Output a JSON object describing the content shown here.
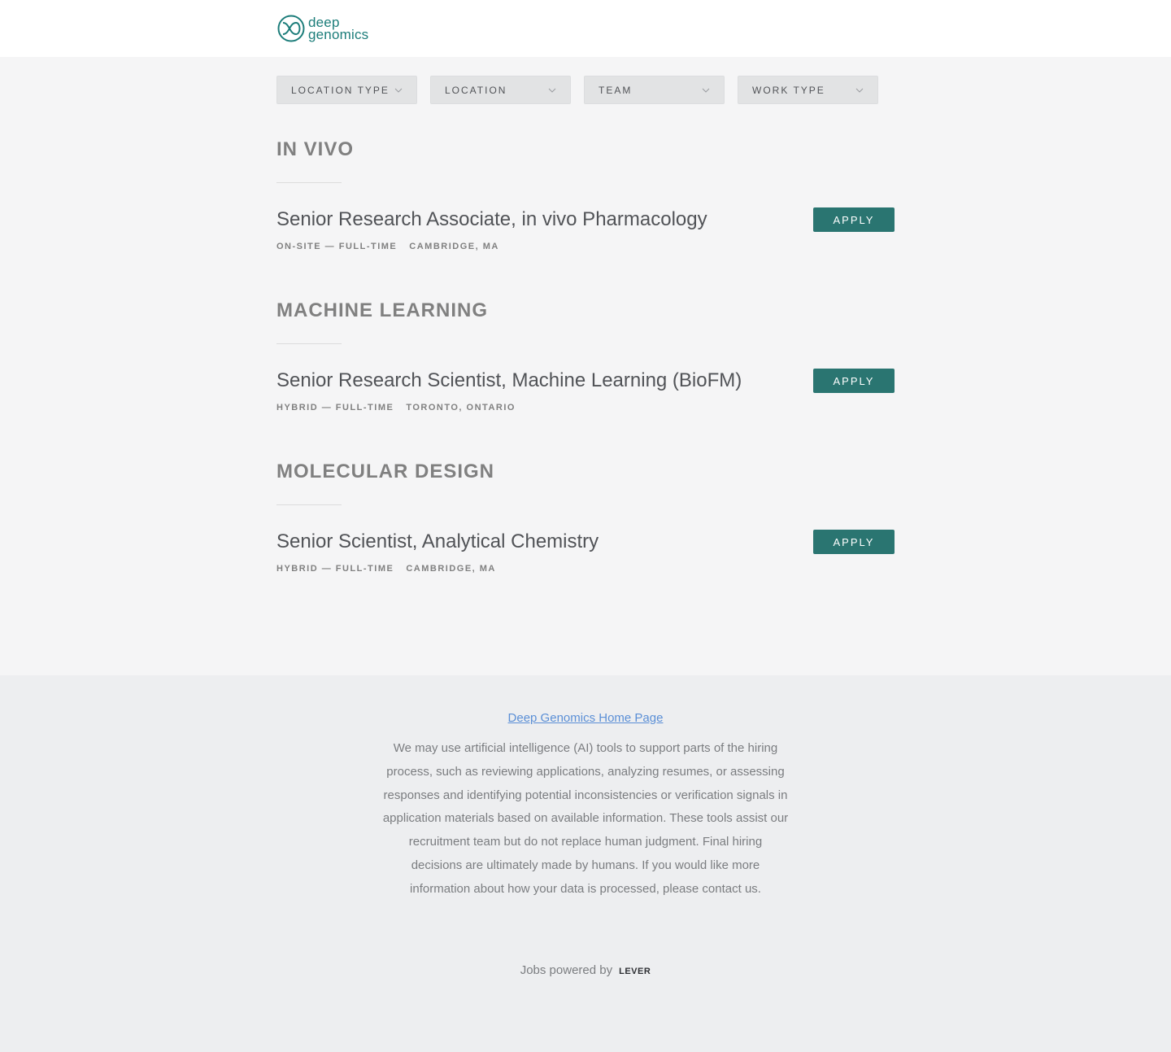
{
  "brand": {
    "logo_line1": "deep",
    "logo_line2": "genomics",
    "color": "#1c7d7a"
  },
  "filters": [
    {
      "label": "LOCATION TYPE"
    },
    {
      "label": "LOCATION"
    },
    {
      "label": "TEAM"
    },
    {
      "label": "WORK TYPE"
    }
  ],
  "teams": [
    {
      "name": "IN VIVO",
      "postings": [
        {
          "title": "Senior Research Associate, in vivo Pharmacology",
          "workplace": "ON-SITE — FULL-TIME",
          "location": "CAMBRIDGE, MA",
          "apply_label": "APPLY"
        }
      ]
    },
    {
      "name": "MACHINE LEARNING",
      "postings": [
        {
          "title": "Senior Research Scientist, Machine Learning (BioFM)",
          "workplace": "HYBRID — FULL-TIME",
          "location": "TORONTO, ONTARIO",
          "apply_label": "APPLY"
        }
      ]
    },
    {
      "name": "MOLECULAR DESIGN",
      "postings": [
        {
          "title": "Senior Scientist, Analytical Chemistry",
          "workplace": "HYBRID — FULL-TIME",
          "location": "CAMBRIDGE, MA",
          "apply_label": "APPLY"
        }
      ]
    }
  ],
  "footer": {
    "home_link": "Deep Genomics Home Page",
    "ai_notice": "We may use artificial intelligence (AI) tools to support parts of the hiring process, such as reviewing applications, analyzing resumes, or assessing responses and identifying potential inconsistencies or verification signals in application materials based on available information. These tools assist our recruitment team but do not replace human judgment. Final hiring decisions are ultimately made by humans. If you would like more information about how your data is processed, please contact us.",
    "powered_by": "Jobs powered by",
    "lever": "LEVER"
  },
  "colors": {
    "apply_button": "#2a7571",
    "link": "#5b8fd6",
    "background": "#f5f5f6",
    "footer_background": "#edeef0"
  }
}
